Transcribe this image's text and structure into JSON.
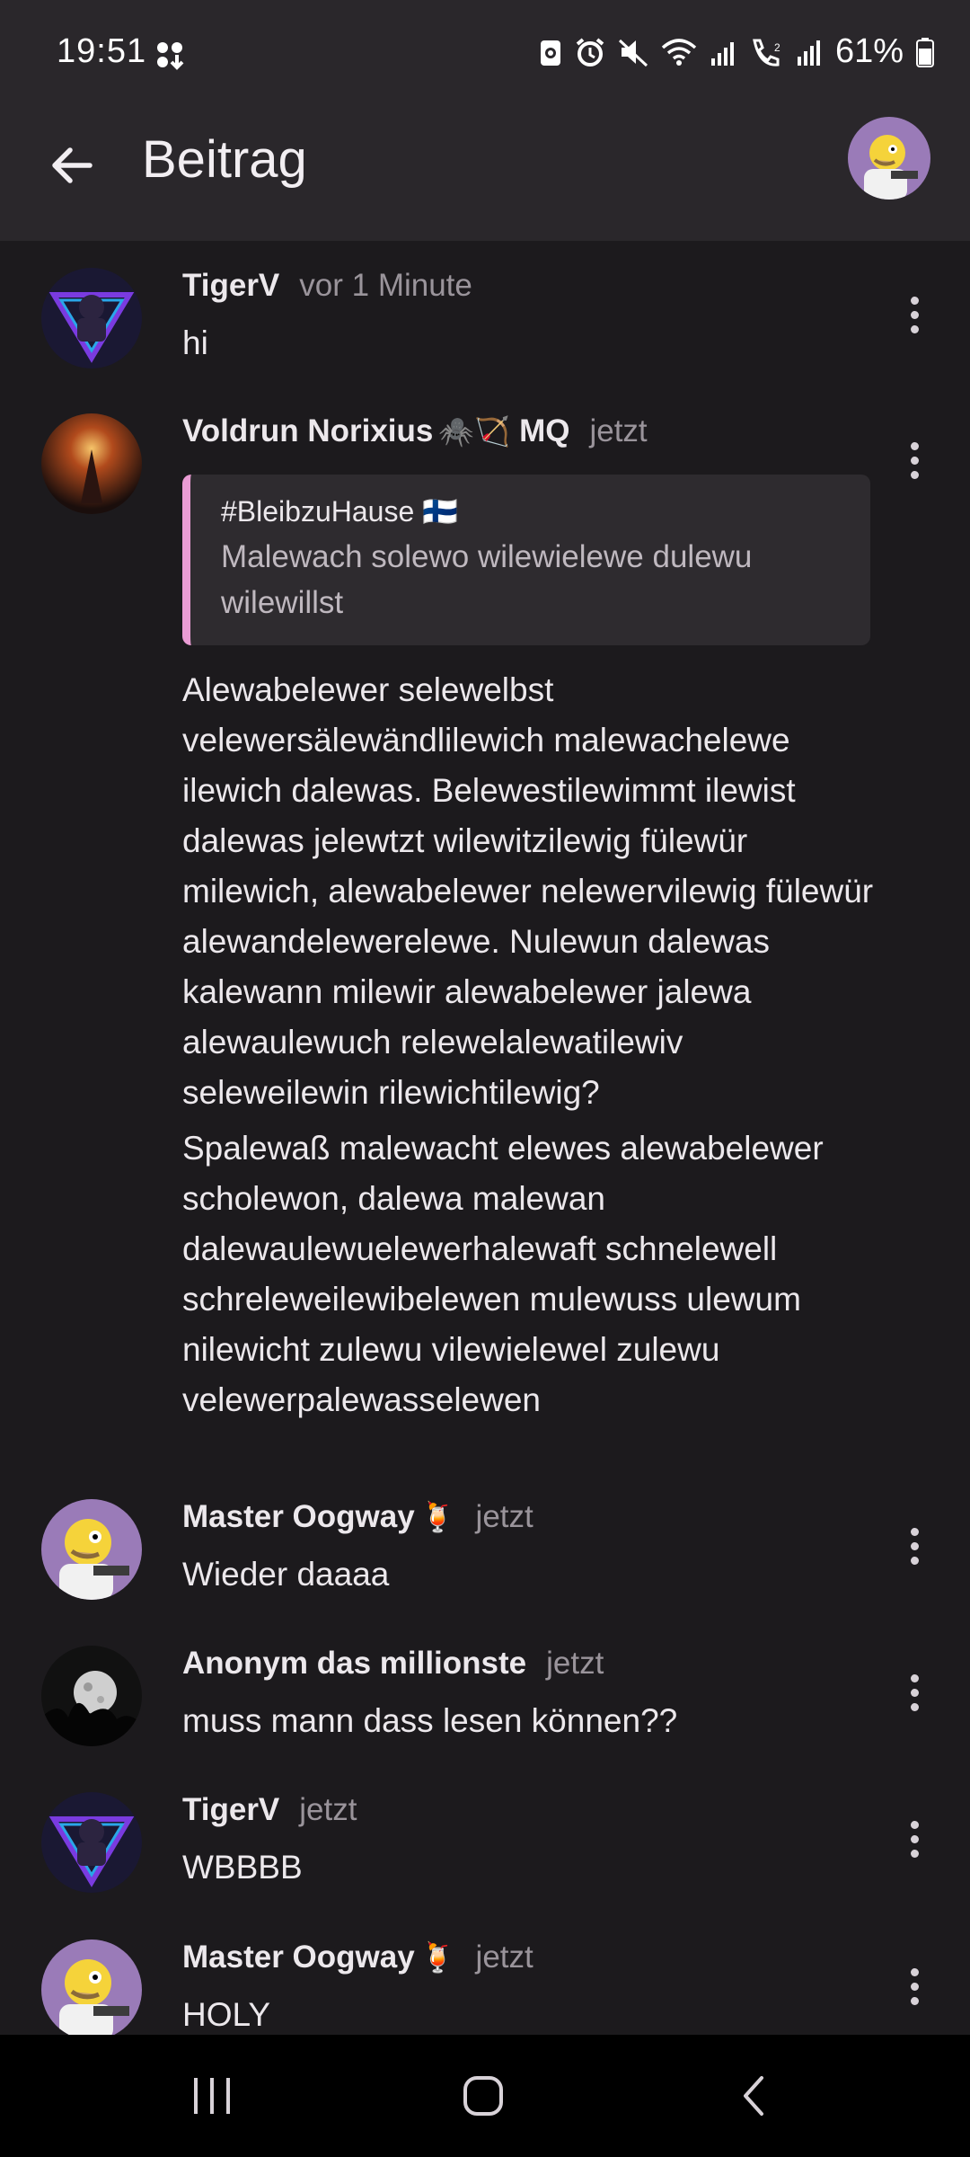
{
  "status_bar": {
    "time": "19:51",
    "battery": "61%",
    "icons": [
      "sync-icon",
      "alarm-icon",
      "mute-icon",
      "wifi-icon",
      "signal-icon",
      "wifi-calling-icon",
      "signal-r-icon",
      "battery-icon"
    ]
  },
  "app_bar": {
    "back_icon": "arrow-left-icon",
    "title": "Beitrag"
  },
  "posts": [
    {
      "username": "TigerV",
      "emoji": "",
      "badge": "",
      "time": "vor 1 Minute",
      "text": "hi"
    },
    {
      "username": "Voldrun Norixius",
      "emoji": "🕷️🏹",
      "badge": "MQ",
      "time": "jetzt",
      "quote": {
        "tag": "#BleibzuHause 🇫🇮",
        "text": "Malewach solewo wilewielewe dulewu wilewillst"
      },
      "paragraphs": [
        "Alewabelewer selewelbst velewersälewändlilewich malewachelewe ilewich dalewas. Belewestilewimmt ilewist dalewas jelewtzt wilewitzilewig fülewür milewich, alewabelewer nelewervilewig fülewür alewandelewerelewe. Nulewun dalewas kalewann milewir alewabelewer jalewa alewaulewuch relewelalewatilewiv seleweilewin rilewichtilewig?",
        "Spalewaß malewacht elewes alewabelewer scholewon, dalewa malewan dalewaulewuelewerhalewaft schnelewell schreleweilewibelewen mulewuss ulewum nilewicht zulewu vilewielewel zulewu velewerpalewasselewen"
      ]
    },
    {
      "username": "Master Oogway",
      "emoji": "🍹",
      "badge": "",
      "time": "jetzt",
      "text": "Wieder daaaa"
    },
    {
      "username": "Anonym das millionste",
      "emoji": "",
      "badge": "",
      "time": "jetzt",
      "text": "muss mann dass lesen können??"
    },
    {
      "username": "TigerV",
      "emoji": "",
      "badge": "",
      "time": "jetzt",
      "text": "WBBBB"
    },
    {
      "username": "Master Oogway",
      "emoji": "🍹",
      "badge": "",
      "time": "jetzt",
      "text": "HOLY"
    }
  ],
  "nav_bar": {
    "buttons": [
      "recent-apps-icon",
      "home-icon",
      "back-icon"
    ]
  },
  "colors": {
    "background": "#1c1a1d",
    "bar": "#2a272b",
    "quote_border": "#ea9cd4",
    "quote_bg": "#2e2b2f",
    "muted_text": "#9a949b"
  }
}
